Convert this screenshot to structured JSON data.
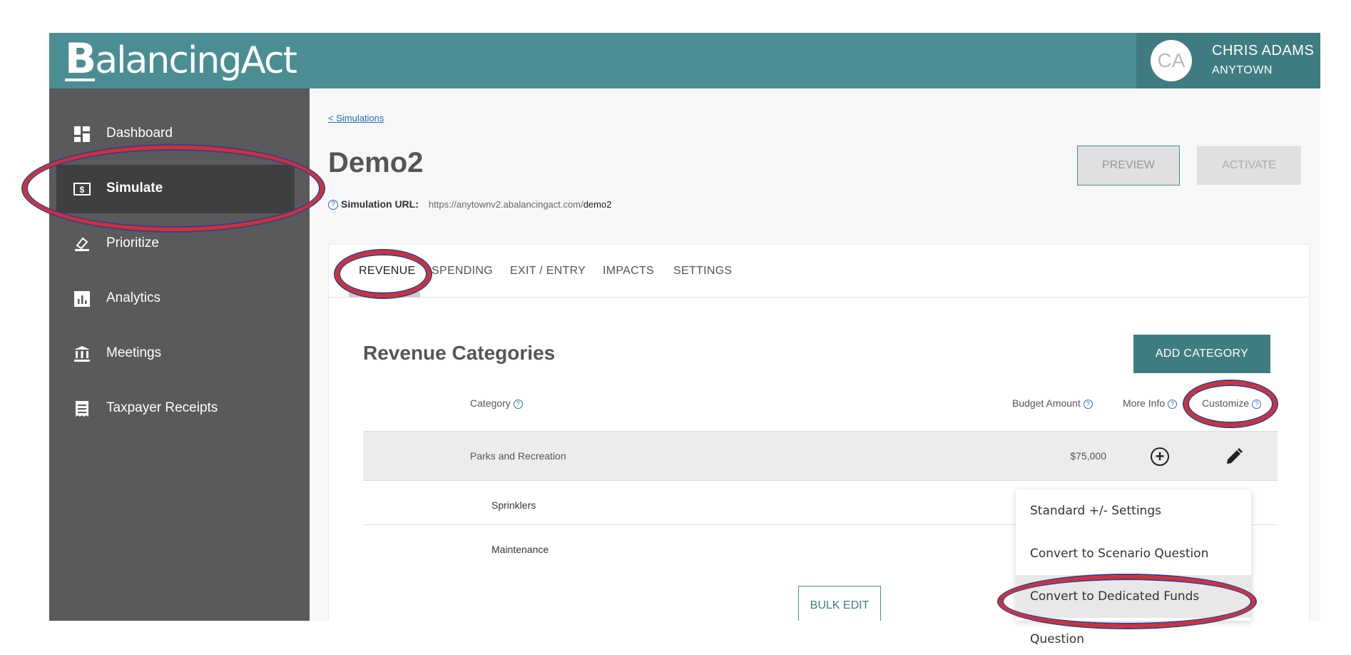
{
  "app": {
    "logo_initial": "B",
    "logo_rest": "alancingAct"
  },
  "user": {
    "initials": "CA",
    "name": "CHRIS ADAMS",
    "town": "ANYTOWN"
  },
  "sidebar": {
    "items": [
      {
        "label": "Dashboard",
        "icon": "dashboard-icon"
      },
      {
        "label": "Simulate",
        "icon": "dollar-bill-icon",
        "active": true
      },
      {
        "label": "Prioritize",
        "icon": "eraser-icon"
      },
      {
        "label": "Analytics",
        "icon": "bar-chart-icon"
      },
      {
        "label": "Meetings",
        "icon": "building-icon"
      },
      {
        "label": "Taxpayer Receipts",
        "icon": "receipt-icon"
      }
    ]
  },
  "main": {
    "breadcrumb": "< Simulations",
    "title": "Demo2",
    "simulation_url_label": "Simulation URL:",
    "simulation_url_base": "https://anytownv2.abalancingact.com/",
    "simulation_url_slug": "demo2",
    "preview_label": "PREVIEW",
    "activate_label": "ACTIVATE",
    "tabs": [
      {
        "label": "REVENUE",
        "active": true
      },
      {
        "label": "SPENDING"
      },
      {
        "label": "EXIT / ENTRY"
      },
      {
        "label": "IMPACTS"
      },
      {
        "label": "SETTINGS"
      }
    ],
    "section_title": "Revenue Categories",
    "add_category_label": "ADD CATEGORY",
    "columns": {
      "category": "Category",
      "budget_amount": "Budget Amount",
      "more_info": "More Info",
      "customize": "Customize"
    },
    "rows": [
      {
        "name": "Parks and Recreation",
        "amount": "$75,000"
      },
      {
        "name": "Sprinklers"
      },
      {
        "name": "Maintenance"
      }
    ],
    "bulk_edit_label": "BULK EDIT"
  },
  "customize_menu": {
    "items": [
      "Standard +/- Settings",
      "Convert to Scenario Question",
      "Convert to Dedicated Funds Question"
    ]
  },
  "colors": {
    "header": "#4a8e94",
    "sidebar": "#595a5c",
    "accent": "#3f7c82",
    "annotation": "#d62f2f"
  }
}
